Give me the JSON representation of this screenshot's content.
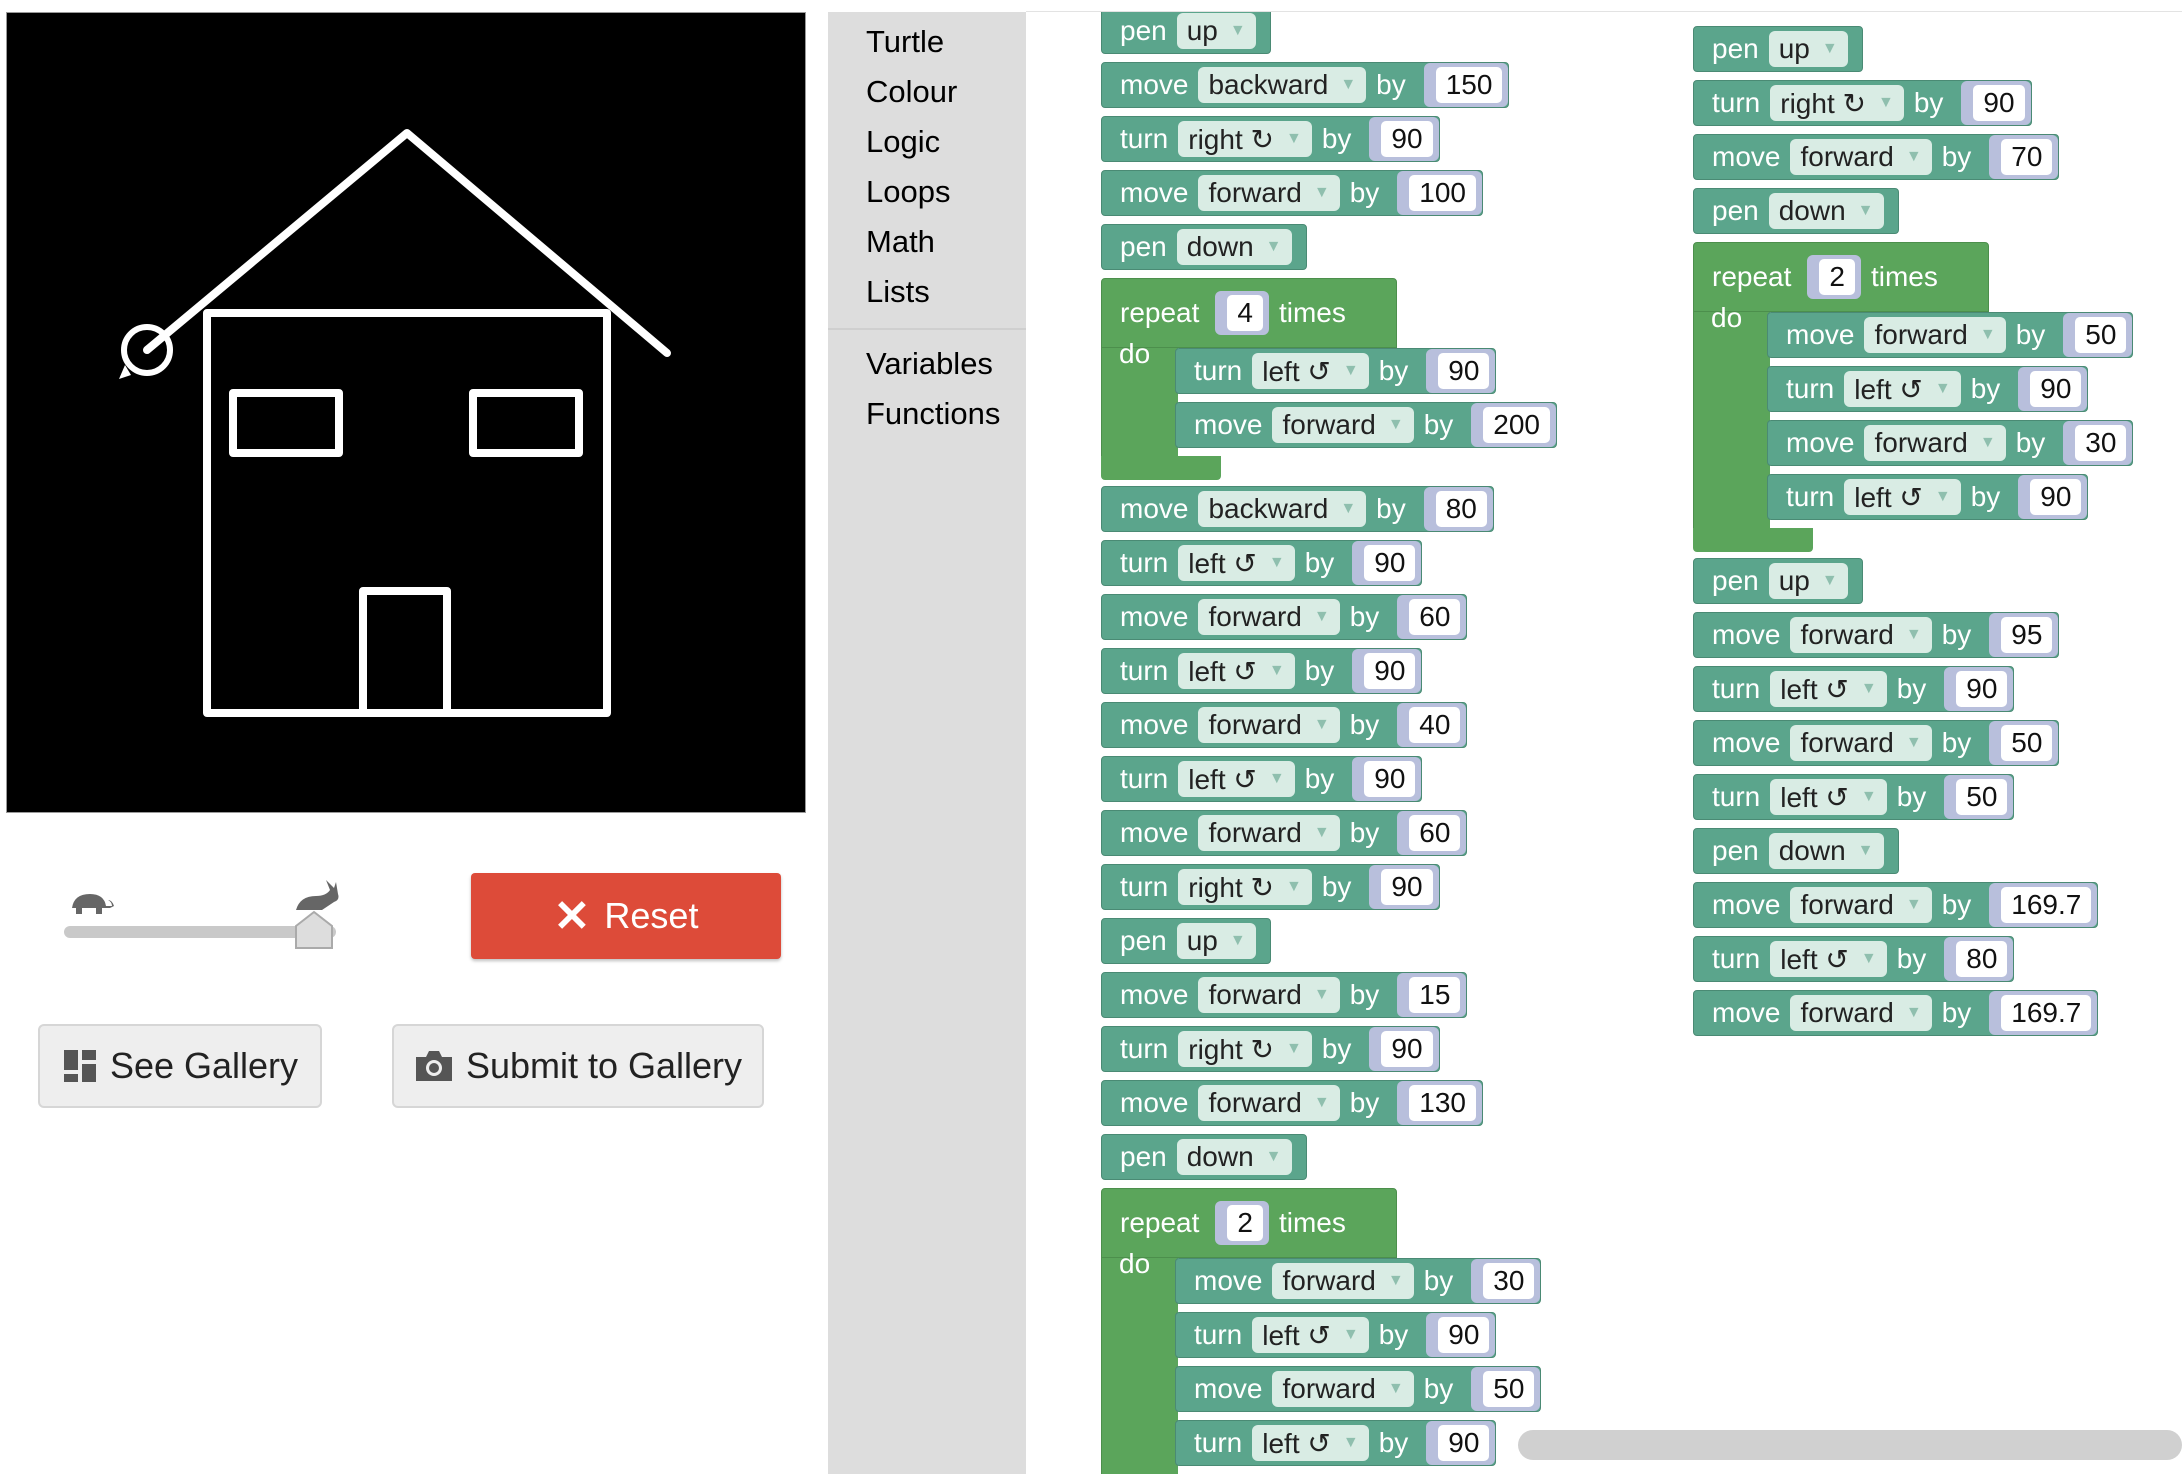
{
  "toolbox": {
    "categories": [
      "Turtle",
      "Colour",
      "Logic",
      "Loops",
      "Math",
      "Lists",
      "Variables",
      "Functions"
    ]
  },
  "controls": {
    "reset_label": "Reset",
    "see_gallery_label": "See Gallery",
    "submit_gallery_label": "Submit to Gallery",
    "speed_level": 1.0
  },
  "colors": {
    "block_turtle": "#5ba58c",
    "block_loop": "#5ba55b",
    "reset_bg": "#dd4b39",
    "canvas_bg": "#000000",
    "drawing": "#ffffff"
  },
  "workspace": {
    "stack1": [
      {
        "kw": "pen",
        "opt": "up"
      },
      {
        "kw": "move",
        "opt": "backward",
        "by": "by",
        "val": "150"
      },
      {
        "kw": "turn",
        "opt": "right ↻",
        "by": "by",
        "val": "90"
      },
      {
        "kw": "move",
        "opt": "forward",
        "by": "by",
        "val": "100"
      },
      {
        "kw": "pen",
        "opt": "down"
      },
      {
        "repeat": "repeat",
        "count": "4",
        "times": "times",
        "do": "do",
        "body": [
          {
            "kw": "turn",
            "opt": "left ↺",
            "by": "by",
            "val": "90"
          },
          {
            "kw": "move",
            "opt": "forward",
            "by": "by",
            "val": "200"
          }
        ]
      },
      {
        "kw": "move",
        "opt": "backward",
        "by": "by",
        "val": "80"
      },
      {
        "kw": "turn",
        "opt": "left ↺",
        "by": "by",
        "val": "90"
      },
      {
        "kw": "move",
        "opt": "forward",
        "by": "by",
        "val": "60"
      },
      {
        "kw": "turn",
        "opt": "left ↺",
        "by": "by",
        "val": "90"
      },
      {
        "kw": "move",
        "opt": "forward",
        "by": "by",
        "val": "40"
      },
      {
        "kw": "turn",
        "opt": "left ↺",
        "by": "by",
        "val": "90"
      },
      {
        "kw": "move",
        "opt": "forward",
        "by": "by",
        "val": "60"
      },
      {
        "kw": "turn",
        "opt": "right ↻",
        "by": "by",
        "val": "90"
      },
      {
        "kw": "pen",
        "opt": "up"
      },
      {
        "kw": "move",
        "opt": "forward",
        "by": "by",
        "val": "15"
      },
      {
        "kw": "turn",
        "opt": "right ↻",
        "by": "by",
        "val": "90"
      },
      {
        "kw": "move",
        "opt": "forward",
        "by": "by",
        "val": "130"
      },
      {
        "kw": "pen",
        "opt": "down"
      },
      {
        "repeat": "repeat",
        "count": "2",
        "times": "times",
        "do": "do",
        "body": [
          {
            "kw": "move",
            "opt": "forward",
            "by": "by",
            "val": "30"
          },
          {
            "kw": "turn",
            "opt": "left ↺",
            "by": "by",
            "val": "90"
          },
          {
            "kw": "move",
            "opt": "forward",
            "by": "by",
            "val": "50"
          },
          {
            "kw": "turn",
            "opt": "left ↺",
            "by": "by",
            "val": "90"
          }
        ]
      }
    ],
    "stack2": [
      {
        "kw": "pen",
        "opt": "up"
      },
      {
        "kw": "turn",
        "opt": "right ↻",
        "by": "by",
        "val": "90"
      },
      {
        "kw": "move",
        "opt": "forward",
        "by": "by",
        "val": "70"
      },
      {
        "kw": "pen",
        "opt": "down"
      },
      {
        "repeat": "repeat",
        "count": "2",
        "times": "times",
        "do": "do",
        "body": [
          {
            "kw": "move",
            "opt": "forward",
            "by": "by",
            "val": "50"
          },
          {
            "kw": "turn",
            "opt": "left ↺",
            "by": "by",
            "val": "90"
          },
          {
            "kw": "move",
            "opt": "forward",
            "by": "by",
            "val": "30"
          },
          {
            "kw": "turn",
            "opt": "left ↺",
            "by": "by",
            "val": "90"
          }
        ]
      },
      {
        "kw": "pen",
        "opt": "up"
      },
      {
        "kw": "move",
        "opt": "forward",
        "by": "by",
        "val": "95"
      },
      {
        "kw": "turn",
        "opt": "left ↺",
        "by": "by",
        "val": "90"
      },
      {
        "kw": "move",
        "opt": "forward",
        "by": "by",
        "val": "50"
      },
      {
        "kw": "turn",
        "opt": "left ↺",
        "by": "by",
        "val": "50"
      },
      {
        "kw": "pen",
        "opt": "down"
      },
      {
        "kw": "move",
        "opt": "forward",
        "by": "by",
        "val": "169.7"
      },
      {
        "kw": "turn",
        "opt": "left ↺",
        "by": "by",
        "val": "80"
      },
      {
        "kw": "move",
        "opt": "forward",
        "by": "by",
        "val": "169.7"
      }
    ]
  }
}
